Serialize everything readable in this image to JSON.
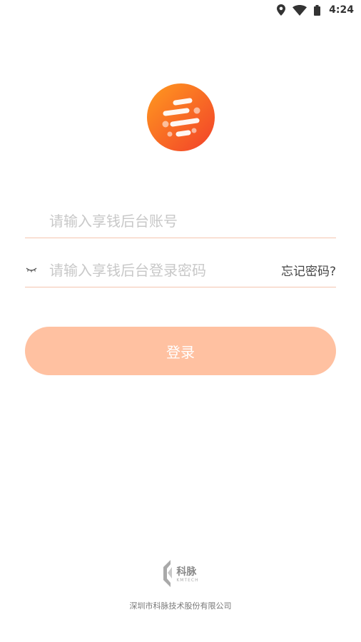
{
  "status_bar": {
    "time": "4:24",
    "icons": [
      "location-pin-icon",
      "wifi-icon",
      "battery-icon"
    ]
  },
  "logo": {
    "icon": "app-logo-icon",
    "colors": [
      "#ff9a1f",
      "#f2402a"
    ]
  },
  "account_field": {
    "placeholder": "请输入享钱后台账号",
    "value": ""
  },
  "password_field": {
    "placeholder": "请输入享钱后台登录密码",
    "value": "",
    "toggle_icon": "eye-closed-icon",
    "forgot_label": "忘记密码?"
  },
  "login_button": {
    "label": "登录",
    "color": "#ffc1a1"
  },
  "footer": {
    "brand_cn": "科脉",
    "brand_en": "KMTECH",
    "company": "深圳市科脉技术股份有限公司"
  },
  "accent_color": "#f4c5ae"
}
